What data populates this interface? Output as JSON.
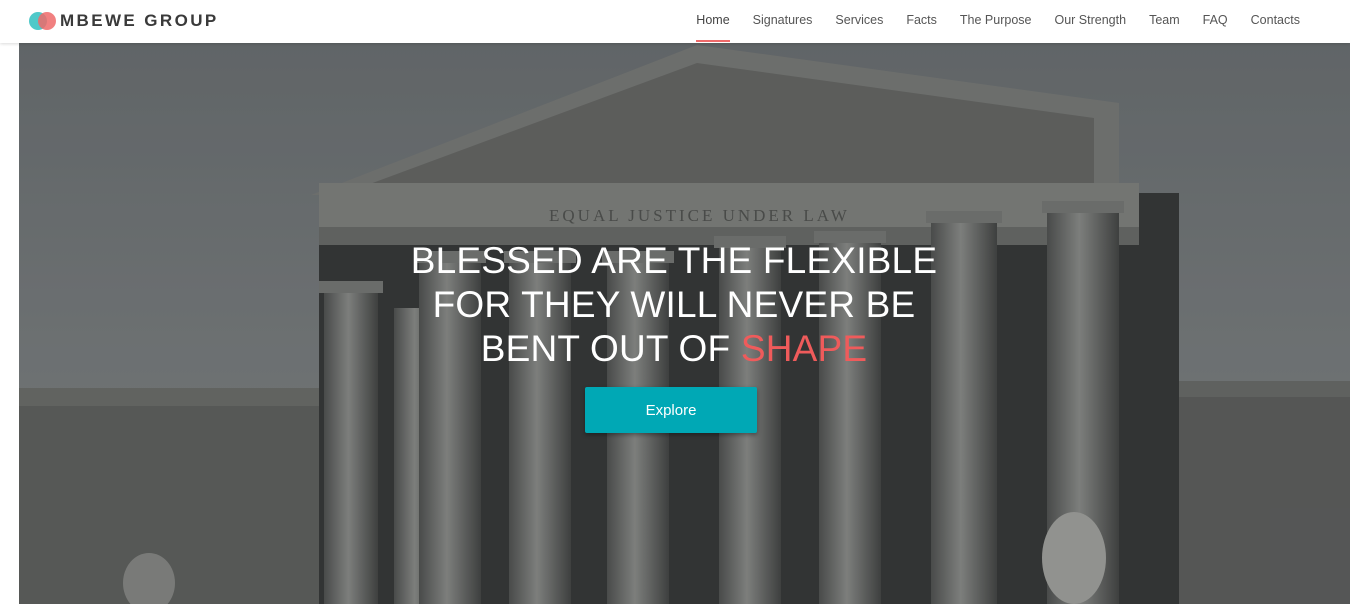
{
  "brand": {
    "name": "MBEWE GROUP"
  },
  "nav": {
    "items": [
      {
        "label": "Home",
        "active": true
      },
      {
        "label": "Signatures"
      },
      {
        "label": "Services"
      },
      {
        "label": "Facts"
      },
      {
        "label": "The Purpose"
      },
      {
        "label": "Our Strength"
      },
      {
        "label": "Team"
      },
      {
        "label": "FAQ"
      },
      {
        "label": "Contacts"
      }
    ]
  },
  "hero": {
    "line1": "BLESSED ARE THE FLEXIBLE",
    "line2": "FOR THEY WILL NEVER BE",
    "line3_prefix": "BENT OUT OF ",
    "line3_accent": "SHAPE",
    "button_label": "Explore",
    "inscription": "EQUAL JUSTICE UNDER LAW"
  },
  "colors": {
    "accent": "#ef5b5b",
    "button": "#00a8b5",
    "logo_teal": "#4fc9c9",
    "logo_coral": "#ef6a6a"
  }
}
